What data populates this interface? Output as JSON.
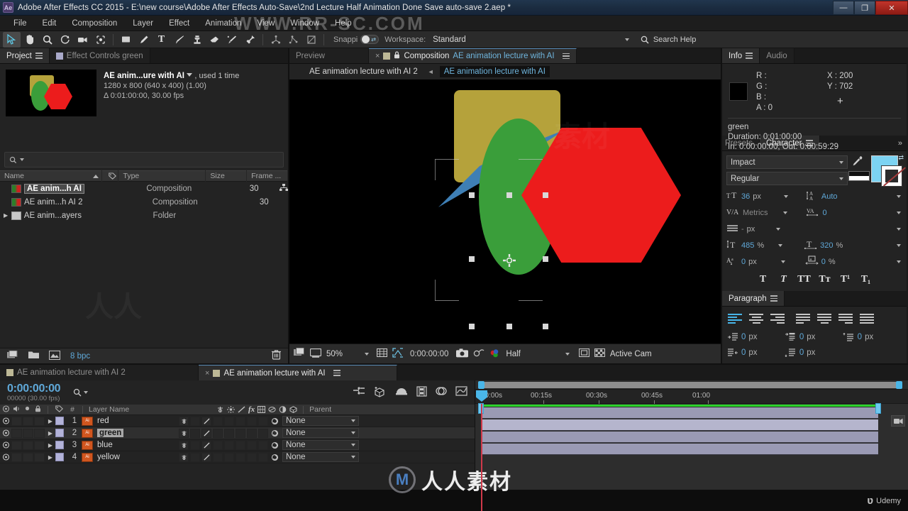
{
  "window": {
    "title": "Adobe After Effects CC 2015 - E:\\new course\\Adobe After Effects Auto-Save\\2nd Lecture Half Animation Done Save auto-save 2.aep *",
    "app_badge": "Ae",
    "minimize": "—",
    "maximize": "❐",
    "close": "✕"
  },
  "menubar": {
    "items": [
      "File",
      "Edit",
      "Composition",
      "Layer",
      "Effect",
      "Animation",
      "View",
      "Window",
      "Help"
    ]
  },
  "toolbar": {
    "tools": [
      {
        "name": "selection-tool",
        "title": "Selection Tool",
        "active": true
      },
      {
        "name": "hand-tool",
        "title": "Hand Tool",
        "active": false
      },
      {
        "name": "zoom-tool",
        "title": "Zoom Tool",
        "active": false
      },
      {
        "name": "rotation-tool",
        "title": "Rotation Tool",
        "active": false
      },
      {
        "name": "camera-tool",
        "title": "Orbit Camera Tool",
        "active": false
      },
      {
        "name": "pan-behind-tool",
        "title": "Pan Behind Tool",
        "active": false
      },
      {
        "name": "shape-tool",
        "title": "Rectangle Tool",
        "active": false
      },
      {
        "name": "pen-tool",
        "title": "Pen Tool",
        "active": false
      },
      {
        "name": "text-tool",
        "title": "Horizontal Type Tool",
        "active": false
      },
      {
        "name": "brush-tool",
        "title": "Brush Tool",
        "active": false
      },
      {
        "name": "clone-stamp-tool",
        "title": "Clone Stamp Tool",
        "active": false
      },
      {
        "name": "eraser-tool",
        "title": "Eraser Tool",
        "active": false
      },
      {
        "name": "roto-brush-tool",
        "title": "Roto Brush Tool",
        "active": false
      },
      {
        "name": "puppet-pin-tool",
        "title": "Puppet Pin Tool",
        "active": false
      }
    ],
    "snapping_label": "Snappi",
    "workspace_label": "Workspace:",
    "workspace_value": "Standard",
    "search_placeholder": "Search Help"
  },
  "project_panel": {
    "tabs": [
      {
        "label": "Project",
        "active": true
      },
      {
        "label": "Effect Controls green",
        "active": false
      }
    ],
    "item": {
      "name": "AE anim...ure with AI",
      "usage": ", used 1 time",
      "dimensions": "1280 x 800  (640 x 400) (1.00)",
      "duration": "Δ 0:01:00:00, 30.00 fps"
    },
    "columns": [
      "Name",
      "Type",
      "Size",
      "Frame ..."
    ],
    "rows": [
      {
        "name": "AE anim...h AI",
        "type": "Composition",
        "size": "",
        "frame": "30",
        "kind": "comp",
        "selected": true
      },
      {
        "name": "AE anim...h AI 2",
        "type": "Composition",
        "size": "",
        "frame": "30",
        "kind": "comp",
        "selected": false
      },
      {
        "name": "AE anim...ayers",
        "type": "Folder",
        "size": "",
        "frame": "",
        "kind": "folder",
        "selected": false
      }
    ],
    "footer": {
      "bpc": "8 bpc"
    }
  },
  "comp_panel": {
    "tabs": [
      {
        "label": "Preview",
        "active": false
      },
      {
        "label": "Composition",
        "name_suffix": "AE animation lecture with AI",
        "active": true
      }
    ],
    "breadcrumb": [
      {
        "label": "AE animation lecture with AI 2",
        "current": false
      },
      {
        "label": "AE animation lecture with AI",
        "current": true
      }
    ],
    "footer": {
      "zoom": "50%",
      "timecode": "0:00:00:00",
      "resolution": "Half",
      "view": "Active Cam"
    },
    "shapes": [
      {
        "name": "yellow-rounded-rect",
        "color": "#b5a23b"
      },
      {
        "name": "blue-star",
        "color": "#3e7fb5"
      },
      {
        "name": "green-ellipse",
        "color": "#3a9e3a"
      },
      {
        "name": "red-hexagon",
        "color": "#ec1c1c"
      }
    ]
  },
  "info_panel": {
    "tabs": [
      {
        "label": "Info",
        "active": true
      },
      {
        "label": "Audio",
        "active": false
      }
    ],
    "r_label": "R :",
    "r_value": "",
    "g_label": "G :",
    "g_value": "",
    "b_label": "B :",
    "b_value": "",
    "a_label": "A :",
    "a_value": "0",
    "x_label": "X :",
    "x_value": "200",
    "y_label": "Y :",
    "y_value": "702",
    "layer_name": "green",
    "duration": "Duration: 0:01:00:00",
    "in_out": "In: 0:00:00:00, Out: 0:00:59:29"
  },
  "character_panel": {
    "tabs": [
      {
        "label": "Presets",
        "active": false
      },
      {
        "label": "Character",
        "active": true
      }
    ],
    "font_family": "Impact",
    "font_style": "Regular",
    "font_size": "36",
    "font_size_unit": "px",
    "leading": "Auto",
    "kerning": "Metrics",
    "tracking": "0",
    "stroke_width": "-",
    "stroke_unit": "px",
    "vertical_scale": "485",
    "vertical_scale_unit": "%",
    "horizontal_scale": "320",
    "horizontal_scale_unit": "%",
    "baseline_shift": "0",
    "baseline_unit": "px",
    "tsume": "0",
    "tsume_unit": "%",
    "fill_color": "#7cd3f2",
    "style_buttons": [
      "T",
      "T",
      "TT",
      "Tт",
      "T¹",
      "T₁"
    ]
  },
  "paragraph_panel": {
    "title": "Paragraph",
    "indent_left": "0",
    "indent_right": "0",
    "space_before": "0",
    "indent_first": "0",
    "space_after": "0",
    "unit": "px"
  },
  "timeline_panel": {
    "tabs": [
      {
        "label": "AE animation lecture with AI 2",
        "active": false
      },
      {
        "label": "AE animation lecture with AI",
        "active": true
      }
    ],
    "timecode": "0:00:00:00",
    "frames": "00000 (30.00 fps)",
    "columns": {
      "layer_name": "Layer Name",
      "parent": "Parent",
      "hash": "#"
    },
    "ruler_ticks": [
      "00:00s",
      "00:15s",
      "00:30s",
      "00:45s",
      "01:00"
    ],
    "layers": [
      {
        "index": "1",
        "name": "red",
        "parent": "None",
        "selected": false
      },
      {
        "index": "2",
        "name": "green",
        "parent": "None",
        "selected": true
      },
      {
        "index": "3",
        "name": "blue",
        "parent": "None",
        "selected": false
      },
      {
        "index": "4",
        "name": "yellow",
        "parent": "None",
        "selected": false
      }
    ]
  },
  "watermarks": {
    "top": "WWW.RR-SC.COM",
    "logo_text": "人人素材",
    "logo_mark": "Μ",
    "udemy": "Udemy"
  }
}
